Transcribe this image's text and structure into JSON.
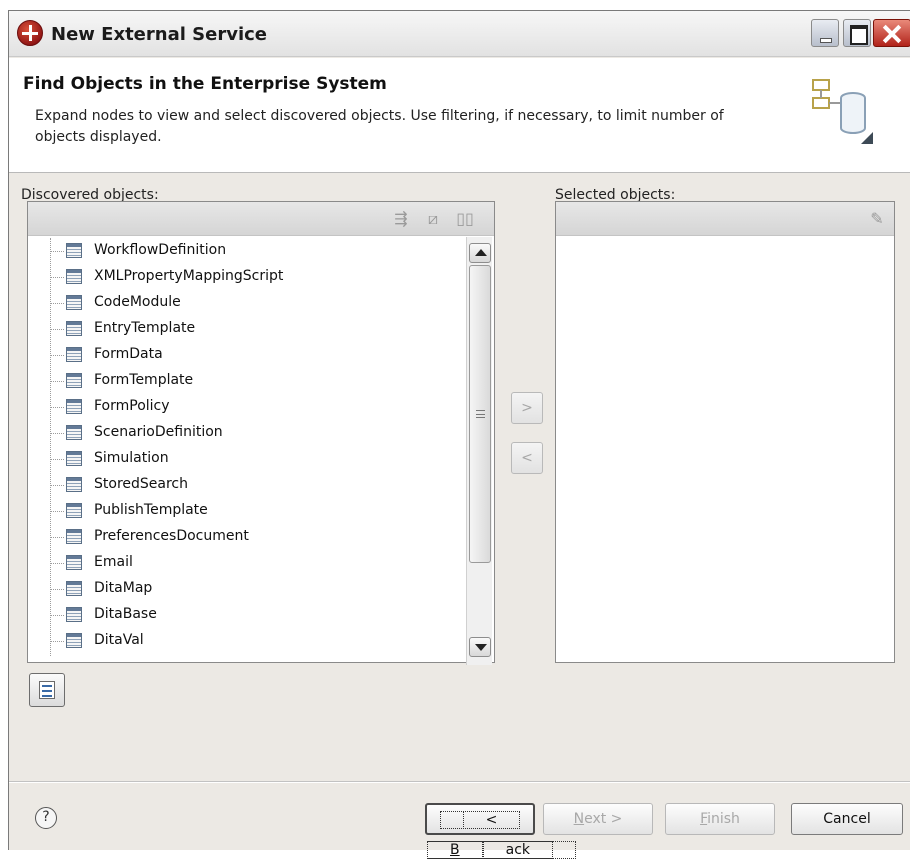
{
  "window": {
    "title": "New External Service"
  },
  "header": {
    "title": "Find Objects in the Enterprise System",
    "description": "Expand nodes to view and select discovered objects.  Use filtering, if necessary, to limit number of objects displayed."
  },
  "discovered": {
    "label": "Discovered objects:",
    "items": [
      "WorkflowDefinition",
      "XMLPropertyMappingScript",
      "CodeModule",
      "EntryTemplate",
      "FormData",
      "FormTemplate",
      "FormPolicy",
      "ScenarioDefinition",
      "Simulation",
      "StoredSearch",
      "PublishTemplate",
      "PreferencesDocument",
      "Email",
      "DitaMap",
      "DitaBase",
      "DitaVal"
    ]
  },
  "selected": {
    "label": "Selected objects:"
  },
  "move": {
    "add": ">",
    "remove": "<"
  },
  "footer": {
    "help": "?",
    "back_prefix": "< ",
    "back_mnemonic": "B",
    "back_rest": "ack",
    "next_mnemonic": "N",
    "next_rest": "ext >",
    "finish_mnemonic": "F",
    "finish_rest": "inish",
    "cancel": "Cancel"
  }
}
